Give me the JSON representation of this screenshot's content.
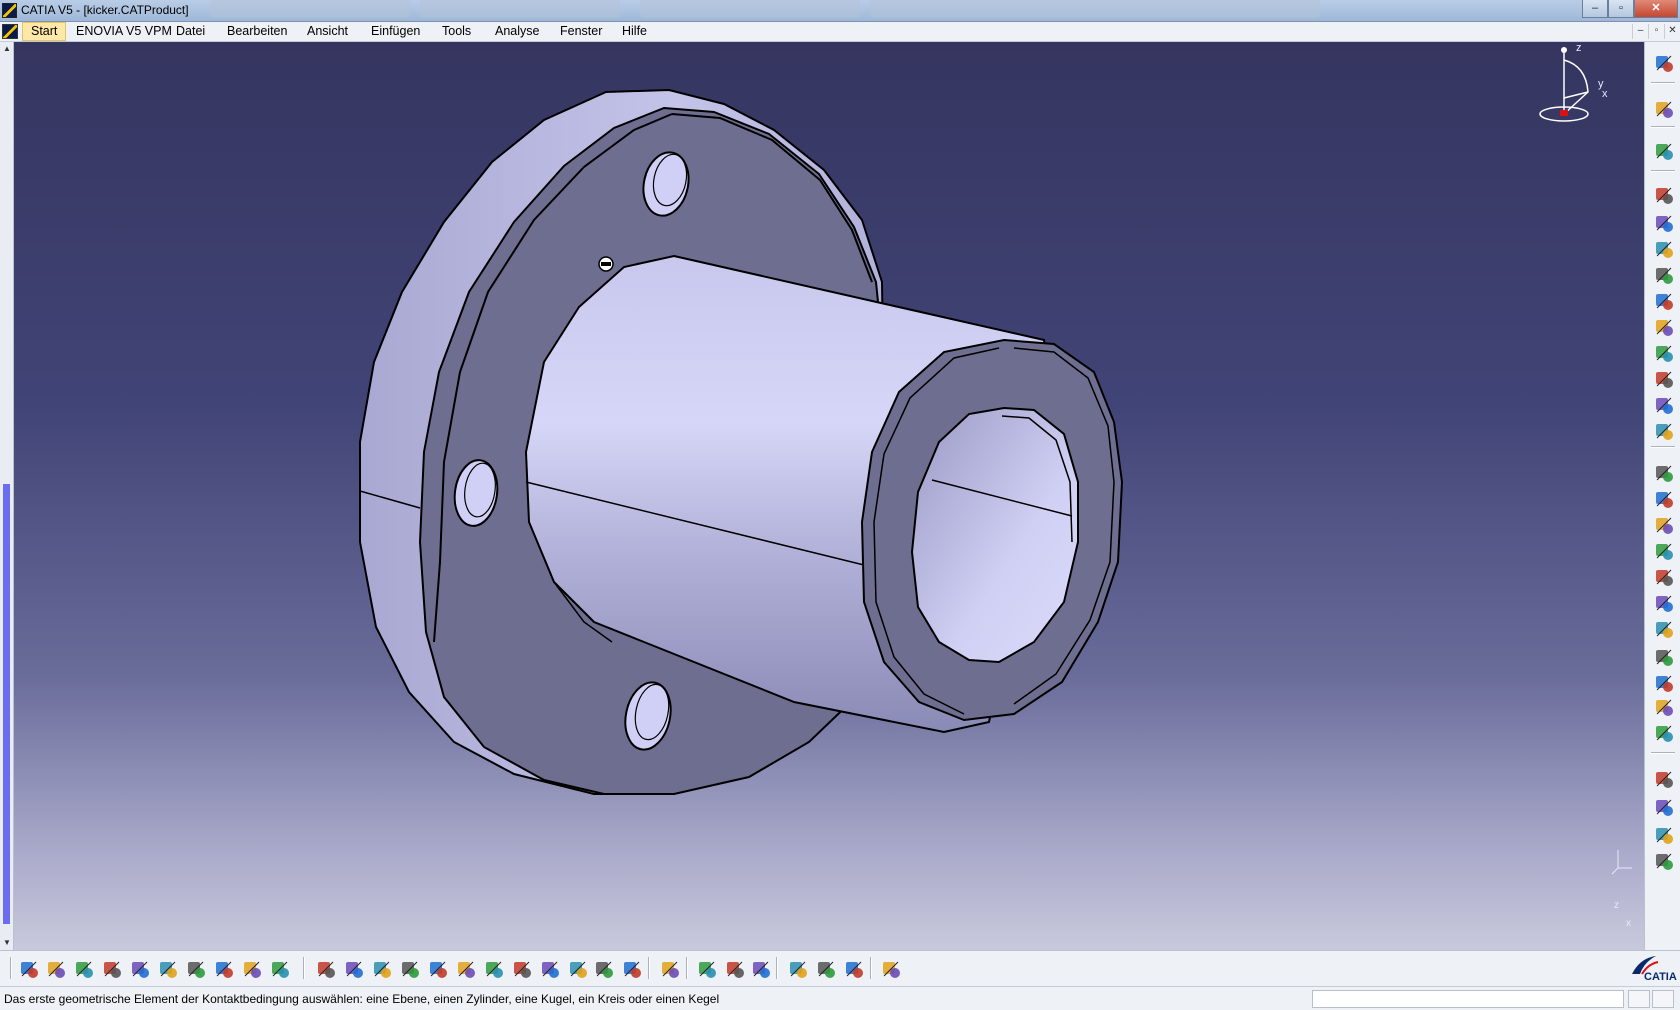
{
  "window": {
    "title": "CATIA V5 - [kicker.CATProduct]",
    "controls": [
      "‒",
      "▫",
      "✕"
    ]
  },
  "menubar": {
    "items": [
      "Start",
      "ENOVIA V5 VPM",
      "Datei",
      "Bearbeiten",
      "Ansicht",
      "Einfügen",
      "Tools",
      "Analyse",
      "Fenster",
      "Hilfe"
    ]
  },
  "viewport": {
    "compass_axes": {
      "z": "z",
      "y": "y",
      "x": "x"
    },
    "mini_axes": {
      "z": "z",
      "x": "x"
    }
  },
  "toolbars": {
    "right": [
      "gear-icon",
      "select-arrow-icon",
      "manipulate-icon",
      "chain-icon",
      "assembly-cube-icon",
      "constraint-icon",
      "fix-icon",
      "anchor-icon",
      "paperclip-icon",
      "snap-icon",
      "explode-icon",
      "update-icon",
      "contact-icon",
      "gear-small-icon",
      "part-icon",
      "component-icon",
      "insert-icon",
      "replace-icon",
      "axis-icon",
      "graph-icon",
      "generate-icon",
      "folder-icon",
      "scene-icon",
      "multi-instance-icon",
      "clash-icon",
      "measure-icon",
      "spec-icon",
      "link-icon"
    ],
    "bottom": [
      "new-icon",
      "open-icon",
      "save-icon",
      "print-icon",
      "cut-icon",
      "copy-icon",
      "paste-icon",
      "undo-icon",
      "redo-icon",
      "whats-this-icon",
      "fly-icon",
      "fit-all-icon",
      "pan-icon",
      "rotate-icon",
      "zoom-in-icon",
      "zoom-out-icon",
      "normal-view-icon",
      "multi-view-icon",
      "iso-view-icon",
      "render-style-icon",
      "hide-show-icon",
      "swap-space-icon",
      "catalog-icon",
      "measure-between-icon",
      "measure-item-icon",
      "inertia-icon",
      "material-icon",
      "photo-icon",
      "apply-material-icon",
      "refresh-icon"
    ]
  },
  "colors": {
    "part_light": "#d2d2f2",
    "part_mid": "#a2a2cc",
    "part_dark": "#6e6e90",
    "background_top": "#353560",
    "background_bottom": "#c9c9dd"
  },
  "status": {
    "message": "Das erste geometrische Element der Kontaktbedingung auswählen: eine Ebene, einen Zylinder, eine Kugel, ein Kreis oder einen Kegel",
    "command_value": ""
  },
  "logo": {
    "text": "CATIA"
  }
}
